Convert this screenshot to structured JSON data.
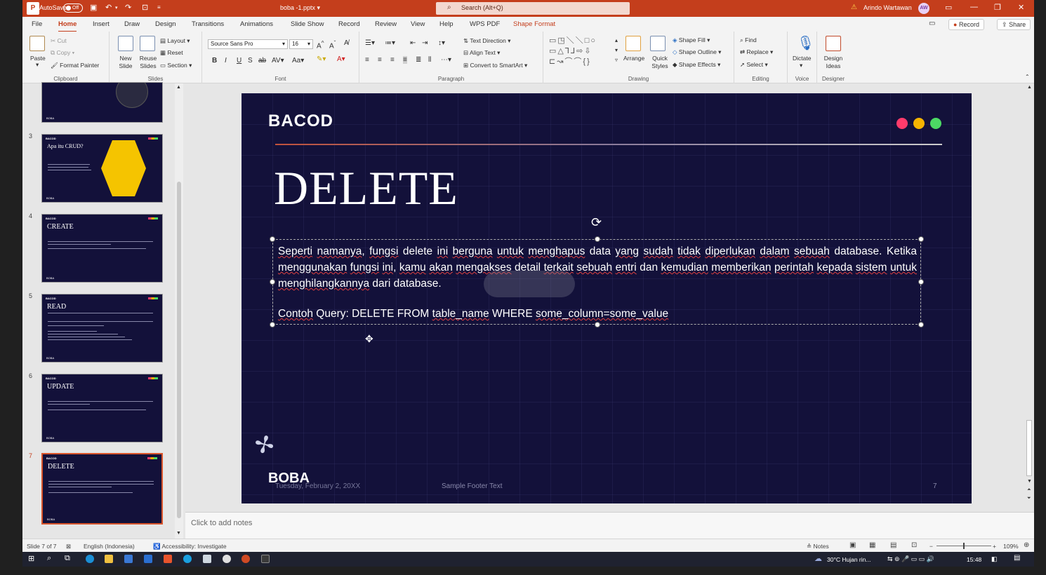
{
  "titlebar": {
    "autosave_label": "AutoSave",
    "autosave_state": "Off",
    "doc_name": "boba -1.pptx",
    "search_placeholder": "Search (Alt+Q)",
    "user_name": "Arindo Wartawan",
    "user_initials": "AW"
  },
  "tabs": [
    "File",
    "Home",
    "Insert",
    "Draw",
    "Design",
    "Transitions",
    "Animations",
    "Slide Show",
    "Record",
    "Review",
    "View",
    "Help",
    "WPS PDF",
    "Shape Format"
  ],
  "tab_active": "Home",
  "tab_actions": {
    "record": "Record",
    "share": "Share"
  },
  "ribbon": {
    "clipboard": {
      "label": "Clipboard",
      "paste": "Paste",
      "cut": "Cut",
      "copy": "Copy",
      "format_painter": "Format Painter"
    },
    "slides": {
      "label": "Slides",
      "new_slide": "New Slide",
      "reuse_slides": "Reuse Slides",
      "layout": "Layout",
      "reset": "Reset",
      "section": "Section"
    },
    "font": {
      "label": "Font",
      "family": "Source Sans Pro",
      "size": "16"
    },
    "paragraph": {
      "label": "Paragraph",
      "text_direction": "Text Direction",
      "align_text": "Align Text",
      "convert_smartart": "Convert to SmartArt"
    },
    "drawing": {
      "label": "Drawing",
      "arrange": "Arrange",
      "quick_styles": "Quick Styles",
      "shape_fill": "Shape Fill",
      "shape_outline": "Shape Outline",
      "shape_effects": "Shape Effects"
    },
    "editing": {
      "label": "Editing",
      "find": "Find",
      "replace": "Replace",
      "select": "Select"
    },
    "voice": {
      "label": "Voice",
      "dictate": "Dictate"
    },
    "designer": {
      "label": "Designer",
      "design_ideas": "Design Ideas"
    }
  },
  "thumbnails": [
    {
      "num": "3",
      "title": "Apa itu CRUD?"
    },
    {
      "num": "4",
      "title": "CREATE"
    },
    {
      "num": "5",
      "title": "READ"
    },
    {
      "num": "6",
      "title": "UPDATE"
    },
    {
      "num": "7",
      "title": "DELETE"
    }
  ],
  "slide": {
    "logo": "BACOD",
    "title": "DELETE",
    "body_parts": [
      {
        "t": "Seperti",
        "sp": true
      },
      {
        "t": " "
      },
      {
        "t": "namanya",
        "sp": true
      },
      {
        "t": ", "
      },
      {
        "t": "fungsi",
        "sp": true
      },
      {
        "t": " delete "
      },
      {
        "t": "ini",
        "sp": true
      },
      {
        "t": " "
      },
      {
        "t": "berguna",
        "sp": true
      },
      {
        "t": " "
      },
      {
        "t": "untuk",
        "sp": true
      },
      {
        "t": " "
      },
      {
        "t": "menghapus",
        "sp": true
      },
      {
        "t": " data "
      },
      {
        "t": "yang",
        "sp": true
      },
      {
        "t": " "
      },
      {
        "t": "sudah",
        "sp": true
      },
      {
        "t": " "
      },
      {
        "t": "tidak",
        "sp": true
      },
      {
        "t": " "
      },
      {
        "t": "diperlukan",
        "sp": true
      },
      {
        "t": " "
      },
      {
        "t": "dalam",
        "sp": true
      },
      {
        "t": " "
      },
      {
        "t": "sebuah",
        "sp": true
      },
      {
        "t": " database. Ketika "
      },
      {
        "t": "menggunakan",
        "sp": true
      },
      {
        "t": " "
      },
      {
        "t": "fungsi",
        "sp": true
      },
      {
        "t": " "
      },
      {
        "t": "ini",
        "sp": true
      },
      {
        "t": ", "
      },
      {
        "t": "kamu",
        "sp": true
      },
      {
        "t": " "
      },
      {
        "t": "akan",
        "sp": true
      },
      {
        "t": " "
      },
      {
        "t": "mengakses",
        "sp": true
      },
      {
        "t": " detail "
      },
      {
        "t": "terkait",
        "sp": true
      },
      {
        "t": " "
      },
      {
        "t": "sebuah",
        "sp": true
      },
      {
        "t": " "
      },
      {
        "t": "entri",
        "sp": true
      },
      {
        "t": " dan "
      },
      {
        "t": "kemudian",
        "sp": true
      },
      {
        "t": " "
      },
      {
        "t": "memberikan",
        "sp": true
      },
      {
        "t": " "
      },
      {
        "t": "perintah",
        "sp": true
      },
      {
        "t": " "
      },
      {
        "t": "kepada",
        "sp": true
      },
      {
        "t": " "
      },
      {
        "t": "sistem",
        "sp": true
      },
      {
        "t": " "
      },
      {
        "t": "untuk",
        "sp": true
      },
      {
        "t": " "
      },
      {
        "t": "menghilangkannya",
        "sp": true
      },
      {
        "t": " dari database."
      }
    ],
    "query_parts": [
      {
        "t": "Contoh",
        "sp": true
      },
      {
        "t": " Query: DELETE FROM "
      },
      {
        "t": "table_name",
        "sp": true
      },
      {
        "t": "  WHERE "
      },
      {
        "t": "some_column=some_value",
        "sp": true
      }
    ],
    "footer_logo": "BOBA",
    "footer_date": "Tuesday, February 2, 20XX",
    "footer_text": "Sample Footer Text",
    "footer_num": "7",
    "dot_colors": [
      "#ff3b6b",
      "#f5b400",
      "#4cd964"
    ]
  },
  "notes_placeholder": "Click to add notes",
  "status": {
    "slide_count": "Slide 7 of 7",
    "language": "English (Indonesia)",
    "accessibility": "Accessibility: Investigate",
    "notes": "Notes",
    "zoom": "109%"
  },
  "taskbar": {
    "weather": "30°C  Hujan rin...",
    "time": "15:48"
  },
  "colors": {
    "accent": "#c43e1c",
    "slide_bg": "#13113a"
  }
}
